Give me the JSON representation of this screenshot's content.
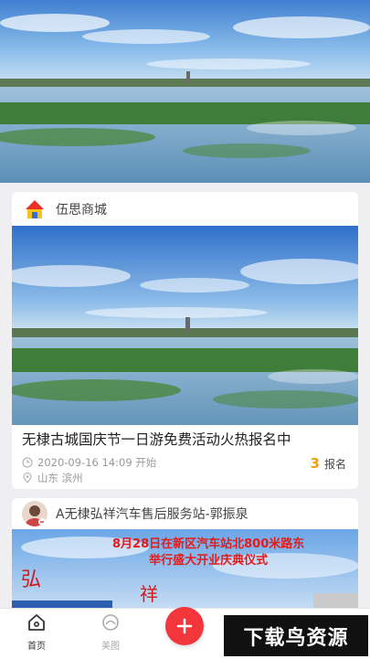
{
  "hero": {
    "image": "lake-landscape-photo"
  },
  "cards": [
    {
      "shop_name": "伍思商城",
      "avatar_icon": "shop-logo-icon",
      "title": "无棣古城国庆节一日游免费活动火热报名中",
      "datetime": "2020-09-16 14:09 开始",
      "location": "山东 滨州",
      "signup_count": "3",
      "signup_label": "报名"
    },
    {
      "shop_name": "A无棣弘祥汽车售后服务站-郭振泉",
      "avatar_icon": "user-avatar",
      "banner_line1": "8月28日在新区汽车站北800米路东",
      "banner_line2": "举行盛大开业庆典仪式"
    }
  ],
  "tabbar": {
    "home": "首页",
    "pics": "美图"
  },
  "watermark": "下载鸟资源",
  "colors": {
    "accent": "#f2363c",
    "count": "#f2a012"
  }
}
